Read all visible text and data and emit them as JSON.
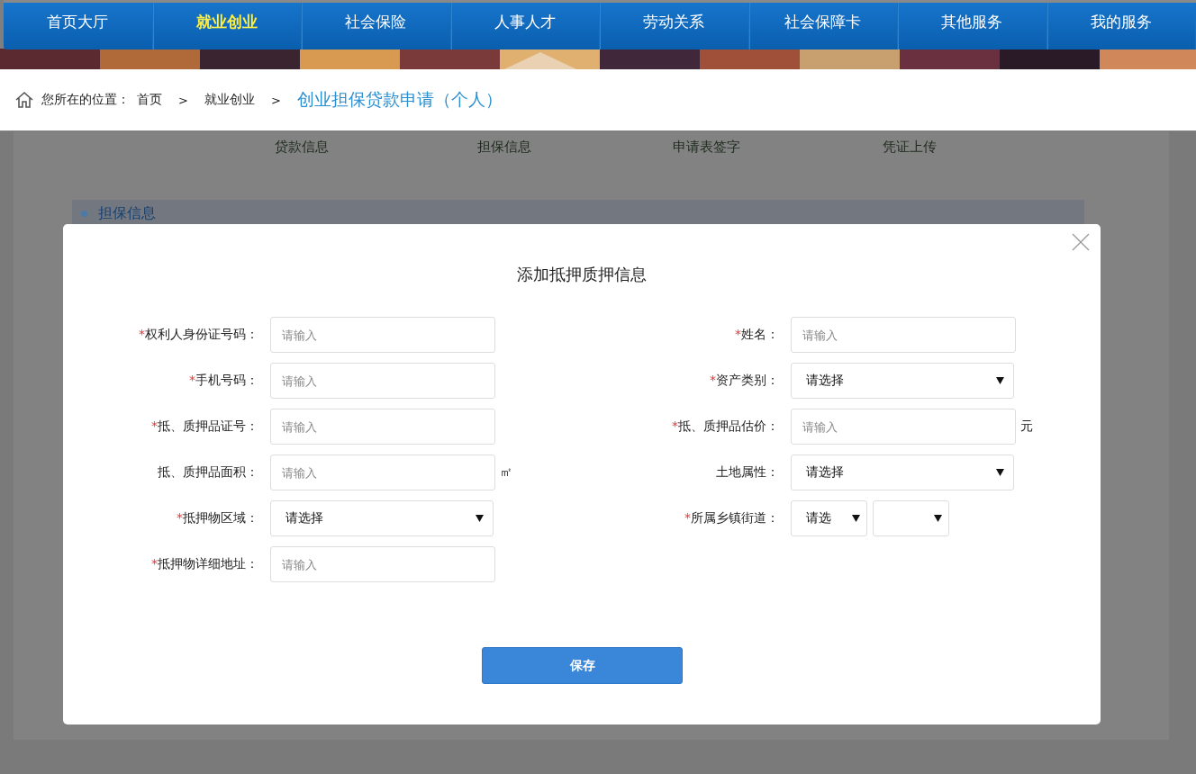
{
  "nav": {
    "items": [
      {
        "label": "首页大厅",
        "selected": false
      },
      {
        "label": "就业创业",
        "selected": true
      },
      {
        "label": "社会保险",
        "selected": false
      },
      {
        "label": "人事人才",
        "selected": false
      },
      {
        "label": "劳动关系",
        "selected": false
      },
      {
        "label": "社会保障卡",
        "selected": false
      },
      {
        "label": "其他服务",
        "selected": false
      },
      {
        "label": "我的服务",
        "selected": false
      }
    ]
  },
  "breadcrumb": {
    "prefix": "您所在的位置：",
    "links": [
      "首页",
      "就业创业"
    ],
    "separator": ">",
    "current": "创业担保贷款申请（个人）"
  },
  "steps": [
    "贷款信息",
    "担保信息",
    "申请表签字",
    "凭证上传"
  ],
  "section": {
    "title": "担保信息"
  },
  "dialog": {
    "title": "添加抵押质押信息",
    "save_button": "保存",
    "rows": [
      [
        {
          "label": "权利人身份证号码：",
          "required_mark": "*",
          "kind": "input",
          "placeholder": "请输入"
        },
        {
          "label": "姓名：",
          "required_mark": "*",
          "kind": "input",
          "placeholder": "请输入"
        }
      ],
      [
        {
          "label": "手机号码：",
          "required_mark": "*",
          "kind": "input",
          "placeholder": "请输入"
        },
        {
          "label": "资产类别：",
          "required_mark": "*",
          "kind": "select",
          "value": "请选择"
        }
      ],
      [
        {
          "label": "抵、质押品证号：",
          "required_mark": "*",
          "kind": "input",
          "placeholder": "请输入"
        },
        {
          "label": "抵、质押品估价：",
          "required_mark": "*",
          "kind": "input",
          "placeholder": "请输入",
          "unit": "元"
        }
      ],
      [
        {
          "label": "抵、质押品面积：",
          "kind": "input",
          "placeholder": "请输入",
          "unit": "㎡"
        },
        {
          "label": "土地属性：",
          "kind": "select",
          "value": "请选择"
        }
      ],
      [
        {
          "label": "抵押物区域：",
          "required_mark": "*",
          "kind": "select",
          "value": "请选择"
        },
        {
          "label": "所属乡镇街道：",
          "required_mark": "*",
          "kind": "select_pair",
          "value": "请选"
        }
      ],
      [
        {
          "label": "抵押物详细地址：",
          "required_mark": "*",
          "kind": "input",
          "placeholder": "请输入"
        }
      ]
    ]
  }
}
